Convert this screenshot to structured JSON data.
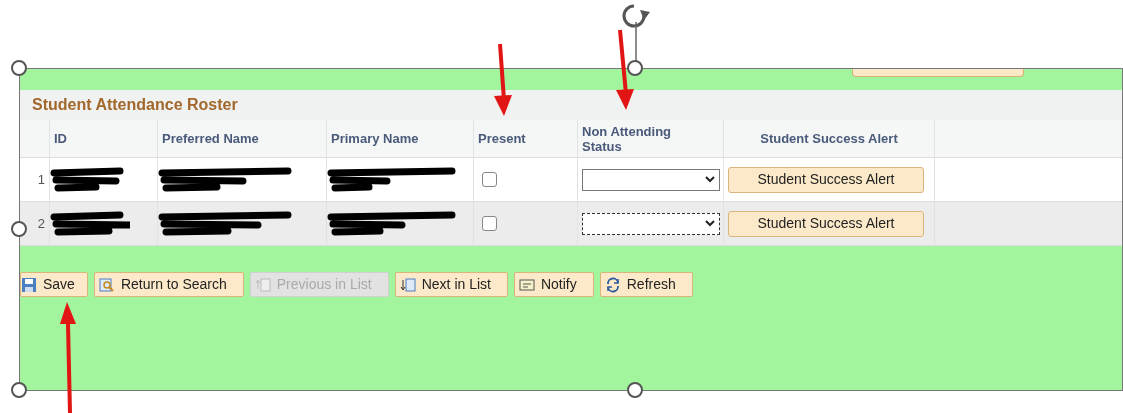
{
  "roster": {
    "title": "Student Attendance Roster",
    "columns": [
      "ID",
      "Preferred Name",
      "Primary Name",
      "Present",
      "Non Attending Status",
      "Student Success Alert"
    ],
    "rows": [
      {
        "number": "1",
        "present": false,
        "status_focused": false,
        "alert_button": "Student Success Alert"
      },
      {
        "number": "2",
        "present": false,
        "status_focused": true,
        "alert_button": "Student Success Alert"
      }
    ]
  },
  "toolbar": [
    {
      "kind": "save",
      "label": "Save",
      "disabled": false
    },
    {
      "kind": "search",
      "label": "Return to Search",
      "disabled": false
    },
    {
      "kind": "previous",
      "label": "Previous in List",
      "disabled": true
    },
    {
      "kind": "next",
      "label": "Next in List",
      "disabled": false
    },
    {
      "kind": "notify",
      "label": "Notify",
      "disabled": false
    },
    {
      "kind": "refresh",
      "label": "Refresh",
      "disabled": false
    }
  ]
}
